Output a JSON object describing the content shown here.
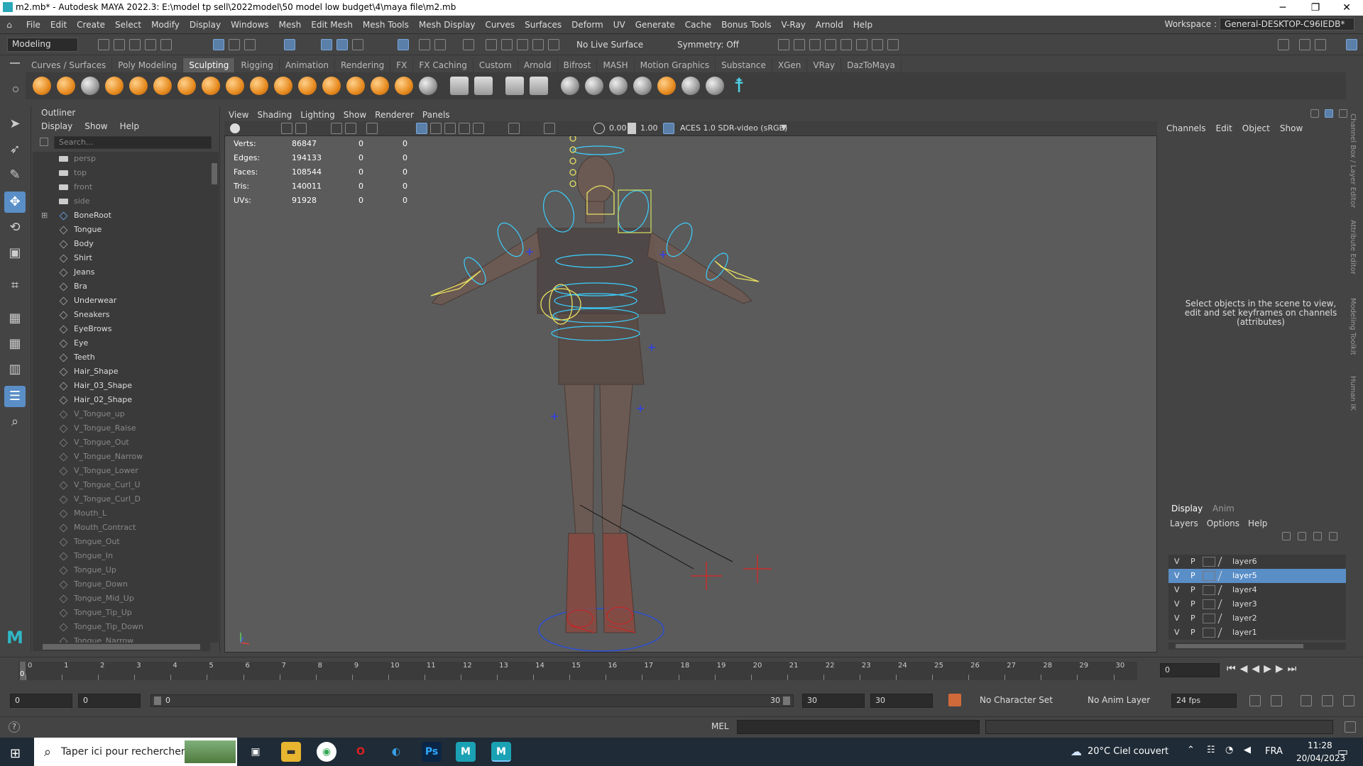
{
  "window": {
    "title": "m2.mb* - Autodesk MAYA 2022.3: E:\\model tp sell\\2022model\\50 model low budget\\4\\maya file\\m2.mb"
  },
  "menus": [
    "File",
    "Edit",
    "Create",
    "Select",
    "Modify",
    "Display",
    "Windows",
    "Mesh",
    "Edit Mesh",
    "Mesh Tools",
    "Mesh Display",
    "Curves",
    "Surfaces",
    "Deform",
    "UV",
    "Generate",
    "Cache",
    "Bonus Tools",
    "V-Ray",
    "Arnold",
    "Help"
  ],
  "workspace": {
    "label": "Workspace :",
    "value": "General-DESKTOP-C96IEDB*"
  },
  "statusline": {
    "menuset": "Modeling",
    "live_surface": "No Live Surface",
    "symmetry": "Symmetry: Off"
  },
  "shelf_tabs": [
    "Curves / Surfaces",
    "Poly Modeling",
    "Sculpting",
    "Rigging",
    "Animation",
    "Rendering",
    "FX",
    "FX Caching",
    "Custom",
    "Arnold",
    "Bifrost",
    "MASH",
    "Motion Graphics",
    "Substance",
    "XGen",
    "VRay",
    "DazToMaya"
  ],
  "shelf_active": "Sculpting",
  "outliner": {
    "title": "Outliner",
    "menu": [
      "Display",
      "Show",
      "Help"
    ],
    "search_placeholder": "Search...",
    "items": [
      {
        "name": "persp",
        "kind": "cam",
        "dim": true
      },
      {
        "name": "top",
        "kind": "cam",
        "dim": true
      },
      {
        "name": "front",
        "kind": "cam",
        "dim": true
      },
      {
        "name": "side",
        "kind": "cam",
        "dim": true
      },
      {
        "name": "BoneRoot",
        "kind": "joint",
        "dim": false
      },
      {
        "name": "Tongue",
        "kind": "mesh",
        "dim": false
      },
      {
        "name": "Body",
        "kind": "mesh",
        "dim": false
      },
      {
        "name": "Shirt",
        "kind": "mesh",
        "dim": false
      },
      {
        "name": "Jeans",
        "kind": "mesh",
        "dim": false
      },
      {
        "name": "Bra",
        "kind": "mesh",
        "dim": false
      },
      {
        "name": "Underwear",
        "kind": "mesh",
        "dim": false
      },
      {
        "name": "Sneakers",
        "kind": "mesh",
        "dim": false
      },
      {
        "name": "EyeBrows",
        "kind": "mesh",
        "dim": false
      },
      {
        "name": "Eye",
        "kind": "mesh",
        "dim": false
      },
      {
        "name": "Teeth",
        "kind": "mesh",
        "dim": false
      },
      {
        "name": "Hair_Shape",
        "kind": "mesh",
        "dim": false
      },
      {
        "name": "Hair_03_Shape",
        "kind": "mesh",
        "dim": false
      },
      {
        "name": "Hair_02_Shape",
        "kind": "mesh",
        "dim": false
      },
      {
        "name": "V_Tongue_up",
        "kind": "mesh",
        "dim": true
      },
      {
        "name": "V_Tongue_Raise",
        "kind": "mesh",
        "dim": true
      },
      {
        "name": "V_Tongue_Out",
        "kind": "mesh",
        "dim": true
      },
      {
        "name": "V_Tongue_Narrow",
        "kind": "mesh",
        "dim": true
      },
      {
        "name": "V_Tongue_Lower",
        "kind": "mesh",
        "dim": true
      },
      {
        "name": "V_Tongue_Curl_U",
        "kind": "mesh",
        "dim": true
      },
      {
        "name": "V_Tongue_Curl_D",
        "kind": "mesh",
        "dim": true
      },
      {
        "name": "Mouth_L",
        "kind": "mesh",
        "dim": true
      },
      {
        "name": "Mouth_Contract",
        "kind": "mesh",
        "dim": true
      },
      {
        "name": "Tongue_Out",
        "kind": "mesh",
        "dim": true
      },
      {
        "name": "Tongue_In",
        "kind": "mesh",
        "dim": true
      },
      {
        "name": "Tongue_Up",
        "kind": "mesh",
        "dim": true
      },
      {
        "name": "Tongue_Down",
        "kind": "mesh",
        "dim": true
      },
      {
        "name": "Tongue_Mid_Up",
        "kind": "mesh",
        "dim": true
      },
      {
        "name": "Tongue_Tip_Up",
        "kind": "mesh",
        "dim": true
      },
      {
        "name": "Tongue_Tip_Down",
        "kind": "mesh",
        "dim": true
      },
      {
        "name": "Tongue_Narrow",
        "kind": "mesh",
        "dim": true
      }
    ]
  },
  "viewport": {
    "menu": [
      "View",
      "Shading",
      "Lighting",
      "Show",
      "Renderer",
      "Panels"
    ],
    "exposure": "0.00",
    "gamma": "1.00",
    "color_space": "ACES 1.0 SDR-video (sRGB)",
    "hud": [
      {
        "label": "Verts:",
        "v": "86847",
        "a": "0",
        "b": "0"
      },
      {
        "label": "Edges:",
        "v": "194133",
        "a": "0",
        "b": "0"
      },
      {
        "label": "Faces:",
        "v": "108544",
        "a": "0",
        "b": "0"
      },
      {
        "label": "Tris:",
        "v": "140011",
        "a": "0",
        "b": "0"
      },
      {
        "label": "UVs:",
        "v": "91928",
        "a": "0",
        "b": "0"
      }
    ]
  },
  "channelbox": {
    "menu": [
      "Channels",
      "Edit",
      "Object",
      "Show"
    ],
    "message": "Select objects in the scene to view, edit and set keyframes on channels (attributes)",
    "side_tabs": [
      "Channel Box / Layer Editor",
      "Attribute Editor",
      "Modeling Toolkit",
      "Human IK"
    ]
  },
  "layer_editor": {
    "tabs": [
      "Display",
      "Anim"
    ],
    "menu": [
      "Layers",
      "Options",
      "Help"
    ],
    "layers": [
      {
        "name": "layer6",
        "v": "V",
        "p": "P",
        "selected": false
      },
      {
        "name": "layer5",
        "v": "V",
        "p": "P",
        "selected": true
      },
      {
        "name": "layer4",
        "v": "V",
        "p": "P",
        "selected": false
      },
      {
        "name": "layer3",
        "v": "V",
        "p": "P",
        "selected": false
      },
      {
        "name": "layer2",
        "v": "V",
        "p": "P",
        "selected": false
      },
      {
        "name": "layer1",
        "v": "V",
        "p": "P",
        "selected": false
      }
    ]
  },
  "timeline": {
    "ticks": [
      "0",
      "1",
      "2",
      "3",
      "4",
      "5",
      "6",
      "7",
      "8",
      "9",
      "10",
      "11",
      "12",
      "13",
      "14",
      "15",
      "16",
      "17",
      "18",
      "19",
      "20",
      "21",
      "22",
      "23",
      "24",
      "25",
      "26",
      "27",
      "28",
      "29",
      "30"
    ],
    "current_frame": "0",
    "current_field": "0",
    "range_start": "0",
    "range_start2": "0",
    "range_bar_start": "0",
    "range_bar_end": "30",
    "range_end": "30",
    "range_end2": "30",
    "character_set": "No Character Set",
    "anim_layer": "No Anim Layer",
    "fps": "24 fps"
  },
  "cmdline": {
    "lang": "MEL"
  },
  "taskbar": {
    "search_placeholder": "Taper ici pour rechercher",
    "weather": "20°C  Ciel couvert",
    "lang": "FRA",
    "time": "11:28",
    "date": "20/04/2023"
  }
}
